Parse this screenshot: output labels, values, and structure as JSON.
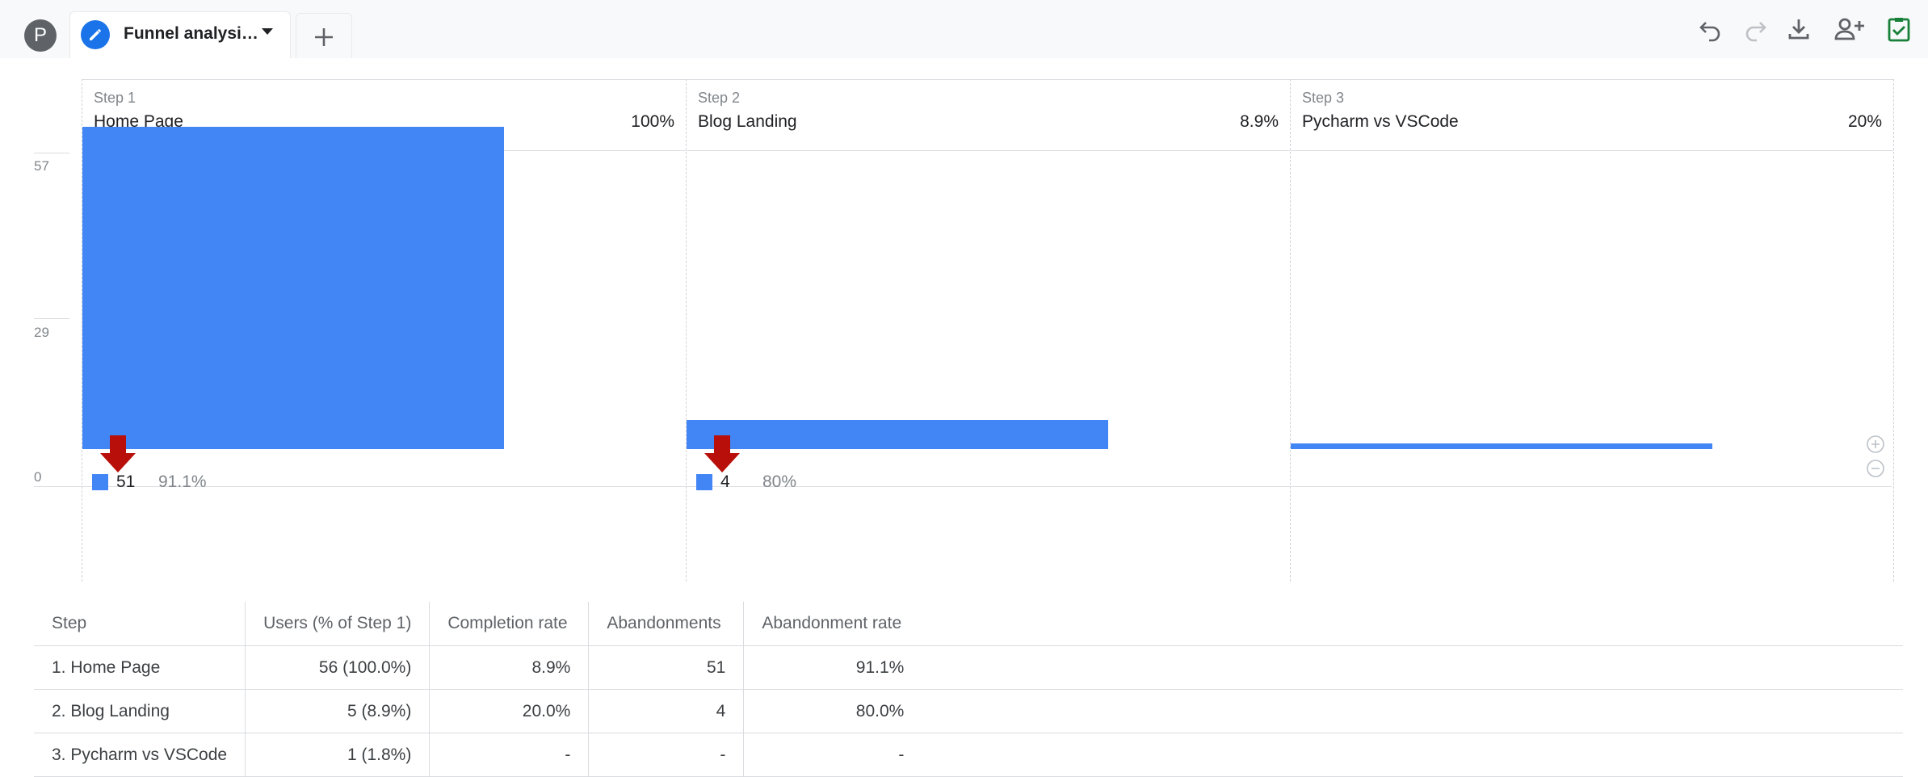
{
  "topbar": {
    "avatar_letter": "P",
    "tab_title": "Funnel analysi…",
    "tools": [
      "undo-icon",
      "redo-icon",
      "download-icon",
      "share-user-icon",
      "check-task-icon"
    ]
  },
  "chart_data": {
    "type": "bar",
    "y_ticks": [
      "57",
      "29",
      "0"
    ],
    "ylim": [
      0,
      57
    ],
    "steps": [
      {
        "step_label": "Step 1",
        "name": "Home Page",
        "percent": "100%",
        "users": 56,
        "dropoff_count": "51",
        "dropoff_rate": "91.1%"
      },
      {
        "step_label": "Step 2",
        "name": "Blog Landing",
        "percent": "8.9%",
        "users": 5,
        "dropoff_count": "4",
        "dropoff_rate": "80%"
      },
      {
        "step_label": "Step 3",
        "name": "Pycharm vs VSCode",
        "percent": "20%",
        "users": 1,
        "dropoff_count": null,
        "dropoff_rate": null
      }
    ],
    "series_color": "#4285f4",
    "dropoff_arrow_color": "#b80f0a"
  },
  "table": {
    "headers": [
      "Step",
      "Users (% of Step 1)",
      "Completion rate",
      "Abandonments",
      "Abandonment rate"
    ],
    "rows": [
      [
        "1. Home Page",
        "56 (100.0%)",
        "8.9%",
        "51",
        "91.1%"
      ],
      [
        "2. Blog Landing",
        "5 (8.9%)",
        "20.0%",
        "4",
        "80.0%"
      ],
      [
        "3. Pycharm vs VSCode",
        "1 (1.8%)",
        "-",
        "-",
        "-"
      ]
    ]
  }
}
